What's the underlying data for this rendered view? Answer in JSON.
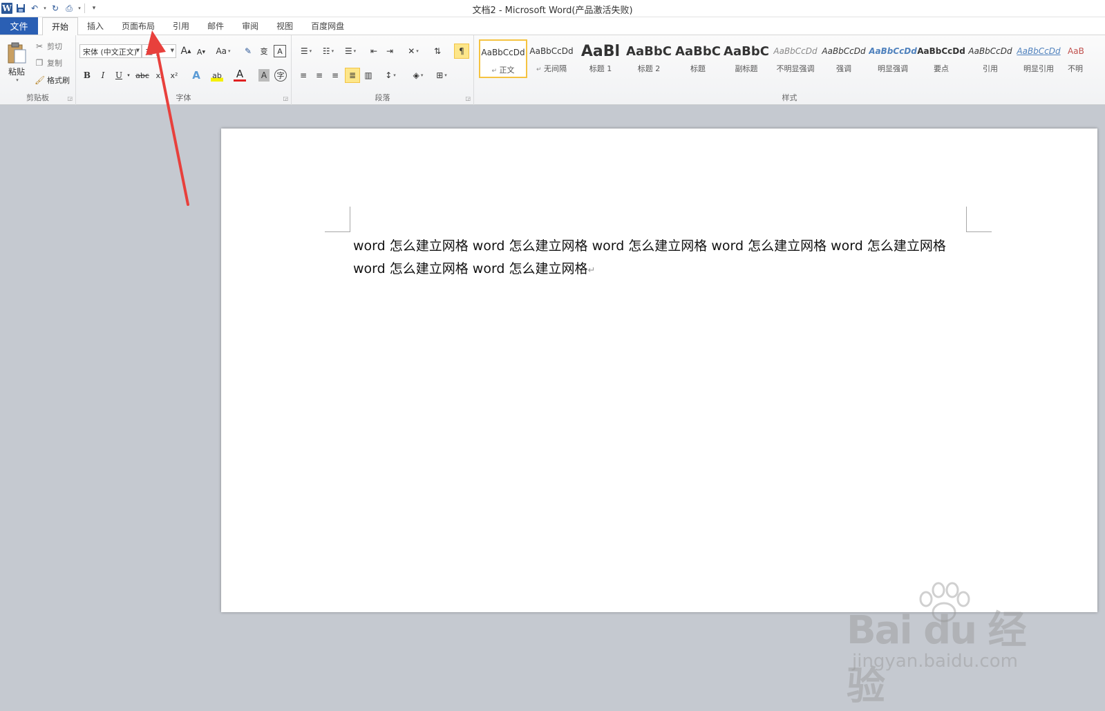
{
  "title": "文档2 - Microsoft Word(产品激活失败)",
  "qat": {
    "word_icon": "W",
    "customize": "▾"
  },
  "tabs": [
    {
      "label": "文件"
    },
    {
      "label": "开始"
    },
    {
      "label": "插入"
    },
    {
      "label": "页面布局"
    },
    {
      "label": "引用"
    },
    {
      "label": "邮件"
    },
    {
      "label": "审阅"
    },
    {
      "label": "视图"
    },
    {
      "label": "百度网盘"
    }
  ],
  "clipboard": {
    "paste": "粘贴",
    "cut": "剪切",
    "copy": "复制",
    "format_painter": "格式刷",
    "group": "剪贴板"
  },
  "font": {
    "name": "宋体 (中文正文)",
    "size": "五号",
    "group": "字体",
    "bold": "B",
    "italic": "I",
    "underline": "U",
    "strike": "abc",
    "sub": "x₂",
    "sup": "x²",
    "grow": "A",
    "shrink": "A",
    "case": "Aa",
    "color_a": "A",
    "shade_a": "A",
    "enclose": "字"
  },
  "paragraph": {
    "group": "段落"
  },
  "styles": {
    "group": "样式",
    "items": [
      {
        "sample": "AaBbCcDd",
        "name": "正文"
      },
      {
        "sample": "AaBbCcDd",
        "name": "无间隔"
      },
      {
        "sample": "AaBl",
        "name": "标题 1"
      },
      {
        "sample": "AaBbC",
        "name": "标题 2"
      },
      {
        "sample": "AaBbC",
        "name": "标题"
      },
      {
        "sample": "AaBbC",
        "name": "副标题"
      },
      {
        "sample": "AaBbCcDd",
        "name": "不明显强调"
      },
      {
        "sample": "AaBbCcDd",
        "name": "强调"
      },
      {
        "sample": "AaBbCcDd",
        "name": "明显强调"
      },
      {
        "sample": "AaBbCcDd",
        "name": "要点"
      },
      {
        "sample": "AaBbCcDd",
        "name": "引用"
      },
      {
        "sample": "AaBbCcDd",
        "name": "明显引用"
      },
      {
        "sample": "AaB",
        "name": "不明"
      }
    ]
  },
  "document": {
    "text": "word 怎么建立网格 word 怎么建立网格 word 怎么建立网格 word 怎么建立网格 word 怎么建立网格 word 怎么建立网格 word 怎么建立网格",
    "para_mark": "↵"
  },
  "watermark": {
    "brand": "Bai du 经验",
    "url": "jingyan.baidu.com"
  },
  "colors": {
    "file_tab": "#2a5fb4",
    "arrow": "#e8403c",
    "style_selected_border": "#f5c340"
  }
}
